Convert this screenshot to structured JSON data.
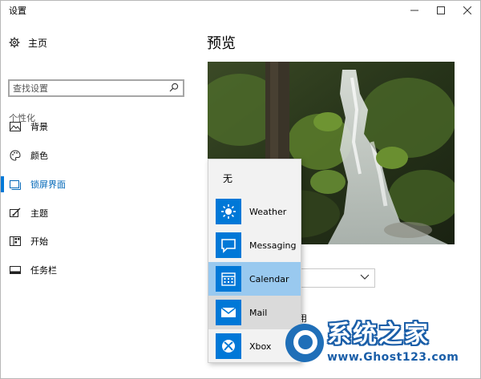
{
  "window": {
    "title": "设置",
    "controls": {
      "minimize": "—",
      "maximize": "☐",
      "close": "✕"
    }
  },
  "sidebar": {
    "home_label": "主页",
    "search": {
      "placeholder": "查找设置"
    },
    "section_header": "个性化",
    "items": [
      {
        "label": "背景",
        "icon": "picture-icon",
        "active": false
      },
      {
        "label": "颜色",
        "icon": "palette-icon",
        "active": false
      },
      {
        "label": "锁屏界面",
        "icon": "lock-screen-icon",
        "active": true
      },
      {
        "label": "主题",
        "icon": "brush-icon",
        "active": false
      },
      {
        "label": "开始",
        "icon": "start-menu-icon",
        "active": false
      },
      {
        "label": "任务栏",
        "icon": "taskbar-icon",
        "active": false
      }
    ]
  },
  "main": {
    "title": "预览",
    "partial_label": "用"
  },
  "app_picker": {
    "none_label": "无",
    "items": [
      {
        "label": "Weather",
        "icon": "sun-icon",
        "state": "normal"
      },
      {
        "label": "Messaging",
        "icon": "chat-bubble-icon",
        "state": "normal"
      },
      {
        "label": "Calendar",
        "icon": "calendar-icon",
        "state": "selected"
      },
      {
        "label": "Mail",
        "icon": "mail-icon",
        "state": "hover"
      },
      {
        "label": "Xbox",
        "icon": "xbox-icon",
        "state": "normal"
      }
    ]
  },
  "watermark": {
    "title": "系统之家",
    "url": "www.Ghost123.com"
  },
  "colors": {
    "accent": "#0078d7",
    "active_text": "#0067b8",
    "selected_item": "#99c9ef",
    "hover_item": "#dadada",
    "popup_bg": "#f2f2f2"
  }
}
